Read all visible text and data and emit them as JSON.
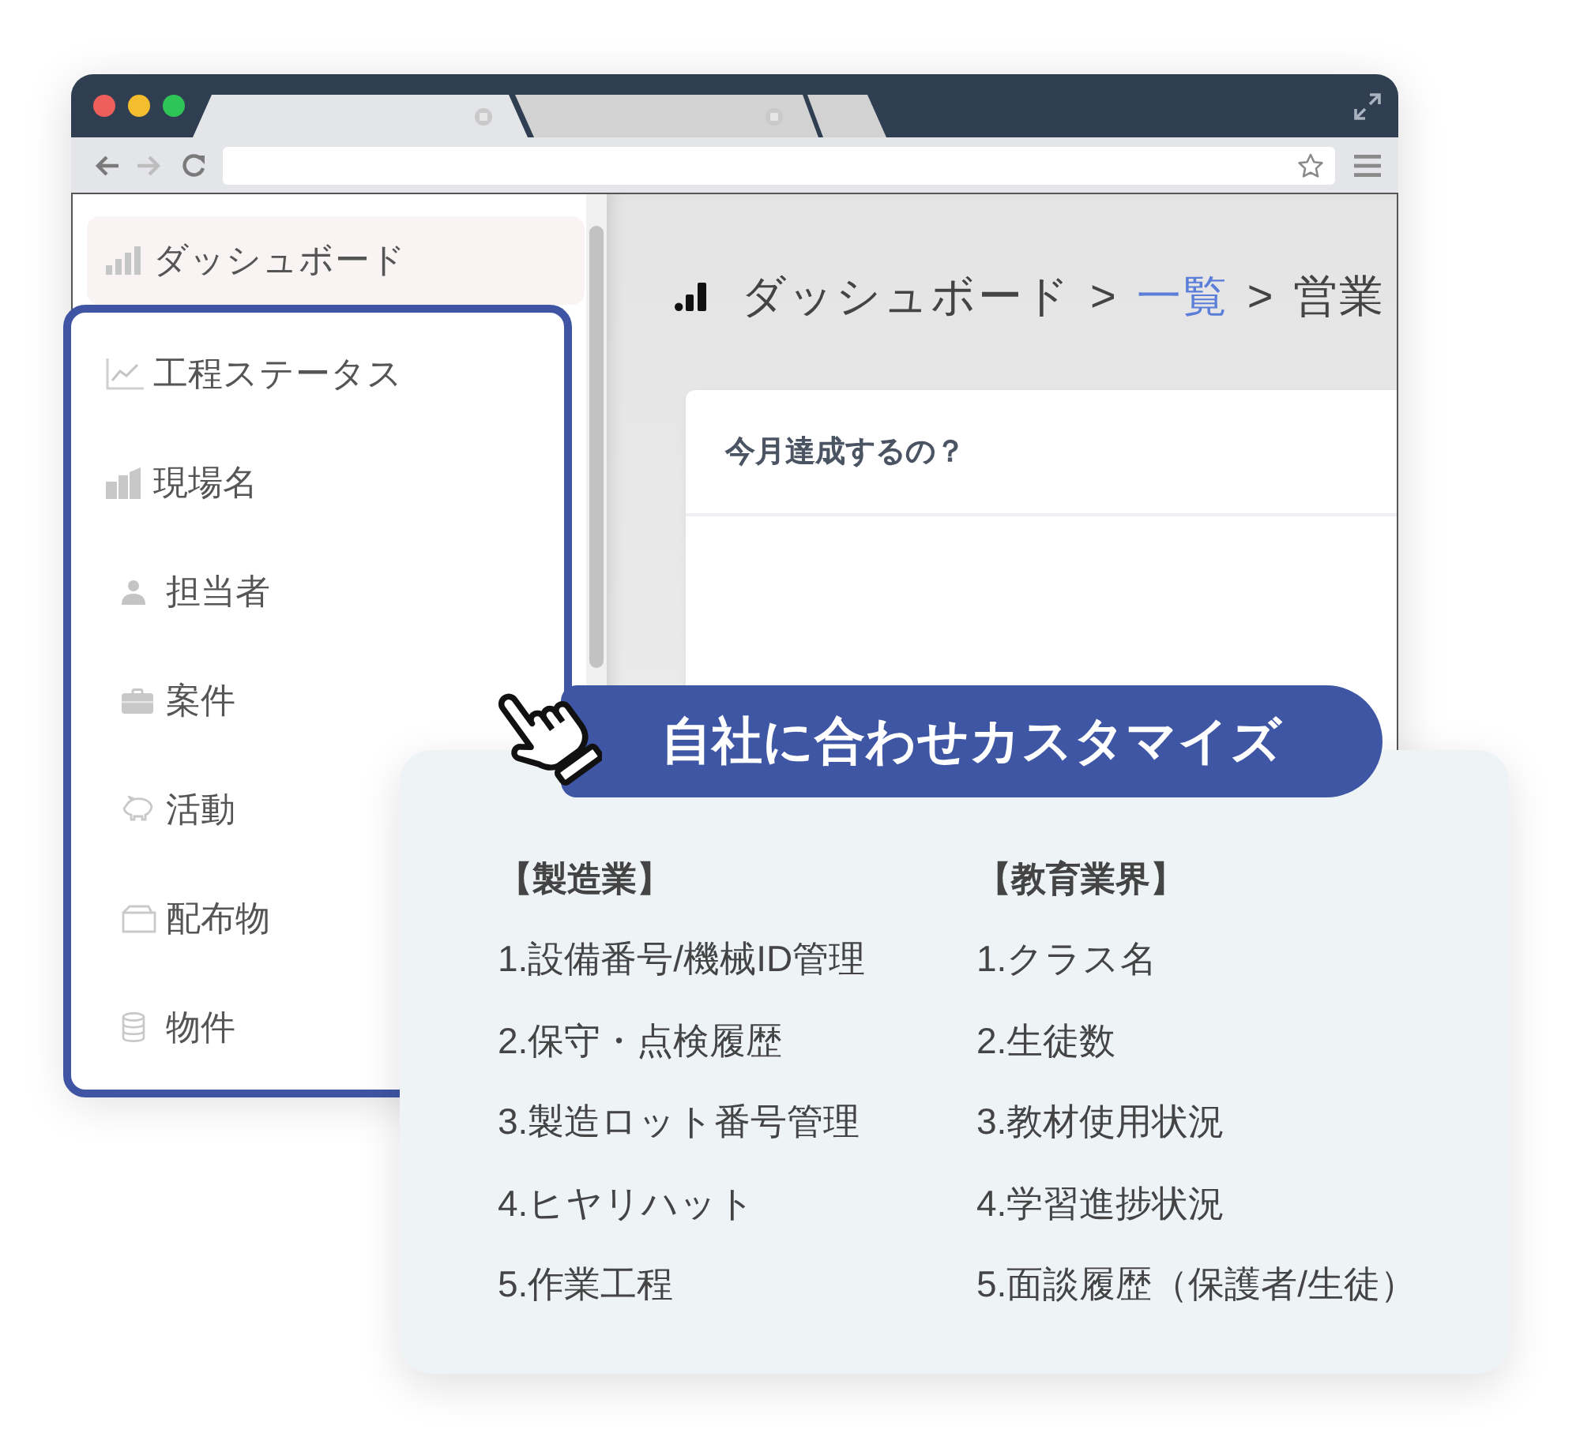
{
  "browser": {
    "tabs": [
      {
        "selected": true
      },
      {
        "selected": false
      }
    ]
  },
  "sidebar": {
    "items": [
      {
        "label": "ダッシュボード",
        "selected": true,
        "highlighted": false
      },
      {
        "label": "工程ステータス",
        "selected": false,
        "highlighted": true
      },
      {
        "label": "現場名",
        "selected": false,
        "highlighted": true
      },
      {
        "label": "担当者",
        "selected": false,
        "highlighted": true
      },
      {
        "label": "案件",
        "selected": false,
        "highlighted": true
      },
      {
        "label": "活動",
        "selected": false,
        "highlighted": true
      },
      {
        "label": "配布物",
        "selected": false,
        "highlighted": true
      },
      {
        "label": "物件",
        "selected": false,
        "highlighted": true
      }
    ]
  },
  "breadcrumb": [
    {
      "kind": "crumb",
      "text": "ダッシュボード",
      "link": false
    },
    {
      "kind": "separator",
      "text": ">"
    },
    {
      "kind": "crumb",
      "text": "一覧",
      "link": true
    },
    {
      "kind": "separator",
      "text": ">"
    },
    {
      "kind": "crumb",
      "text": "営業",
      "link": false
    }
  ],
  "card": {
    "title": "今月達成するの？"
  },
  "callout": {
    "banner": "自社に合わせカスタマイズ",
    "columns": [
      {
        "heading": "【製造業】",
        "items": [
          "1.設備番号/機械ID管理",
          "2.保守・点検履歴",
          "3.製造ロット番号管理",
          "4.ヒヤリハット",
          "5.作業工程"
        ]
      },
      {
        "heading": "【教育業界】",
        "items": [
          "1.クラス名",
          "2.生徒数",
          "3.教材使用状況",
          "4.学習進捗状況",
          "5.面談履歴（保護者/生徒）"
        ]
      }
    ]
  }
}
